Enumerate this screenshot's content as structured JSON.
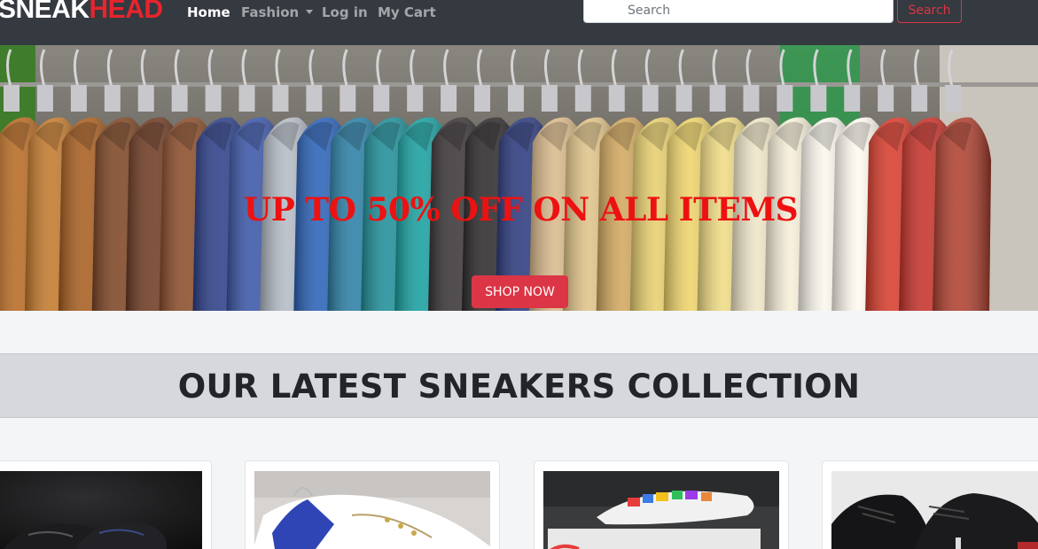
{
  "navbar": {
    "brand_primary": "SNEAK",
    "brand_accent": "HEAD",
    "links": {
      "home": "Home",
      "fashion": "Fashion",
      "login": "Log in",
      "cart": "My Cart"
    },
    "search_placeholder": "Search",
    "search_button": "Search"
  },
  "hero": {
    "title": "UP TO 50% OFF ON ALL ITEMS",
    "cta": "SHOP NOW"
  },
  "section": {
    "title": "OUR LATEST SNEAKERS COLLECTION"
  },
  "colors": {
    "navbar_bg": "#343a40",
    "brand_accent": "#e8242d",
    "danger": "#dc3545",
    "hero_title": "#ee1111",
    "banner_bg": "#d6d8db"
  }
}
